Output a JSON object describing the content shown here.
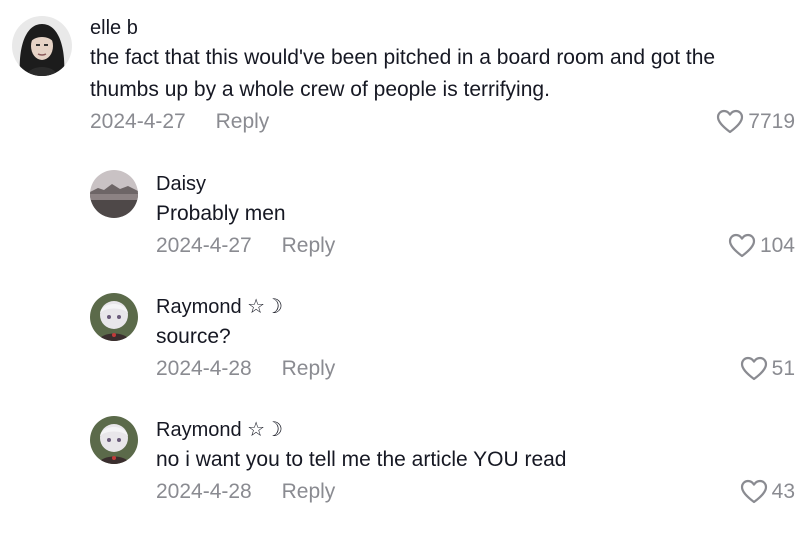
{
  "comments": [
    {
      "username": "elle b",
      "text_lines": [
        "the fact that this would've been pitched in a board room and got the",
        "thumbs up by a whole crew of people is terrifying."
      ],
      "date": "2024-4-27",
      "reply_label": "Reply",
      "likes": "7719"
    }
  ],
  "replies": [
    {
      "username": "Daisy",
      "text": "Probably men",
      "date": "2024-4-27",
      "reply_label": "Reply",
      "likes": "104"
    },
    {
      "username": "Raymond ☆☽",
      "text": "source?",
      "date": "2024-4-28",
      "reply_label": "Reply",
      "likes": "51"
    },
    {
      "username": "Raymond ☆☽",
      "text": "no i want you to tell me the article YOU read",
      "date": "2024-4-28",
      "reply_label": "Reply",
      "likes": "43"
    }
  ],
  "icons": {
    "like": "heart-outline-icon"
  },
  "colors": {
    "text": "#161823",
    "secondary": "#8a8b91",
    "background": "#ffffff"
  }
}
